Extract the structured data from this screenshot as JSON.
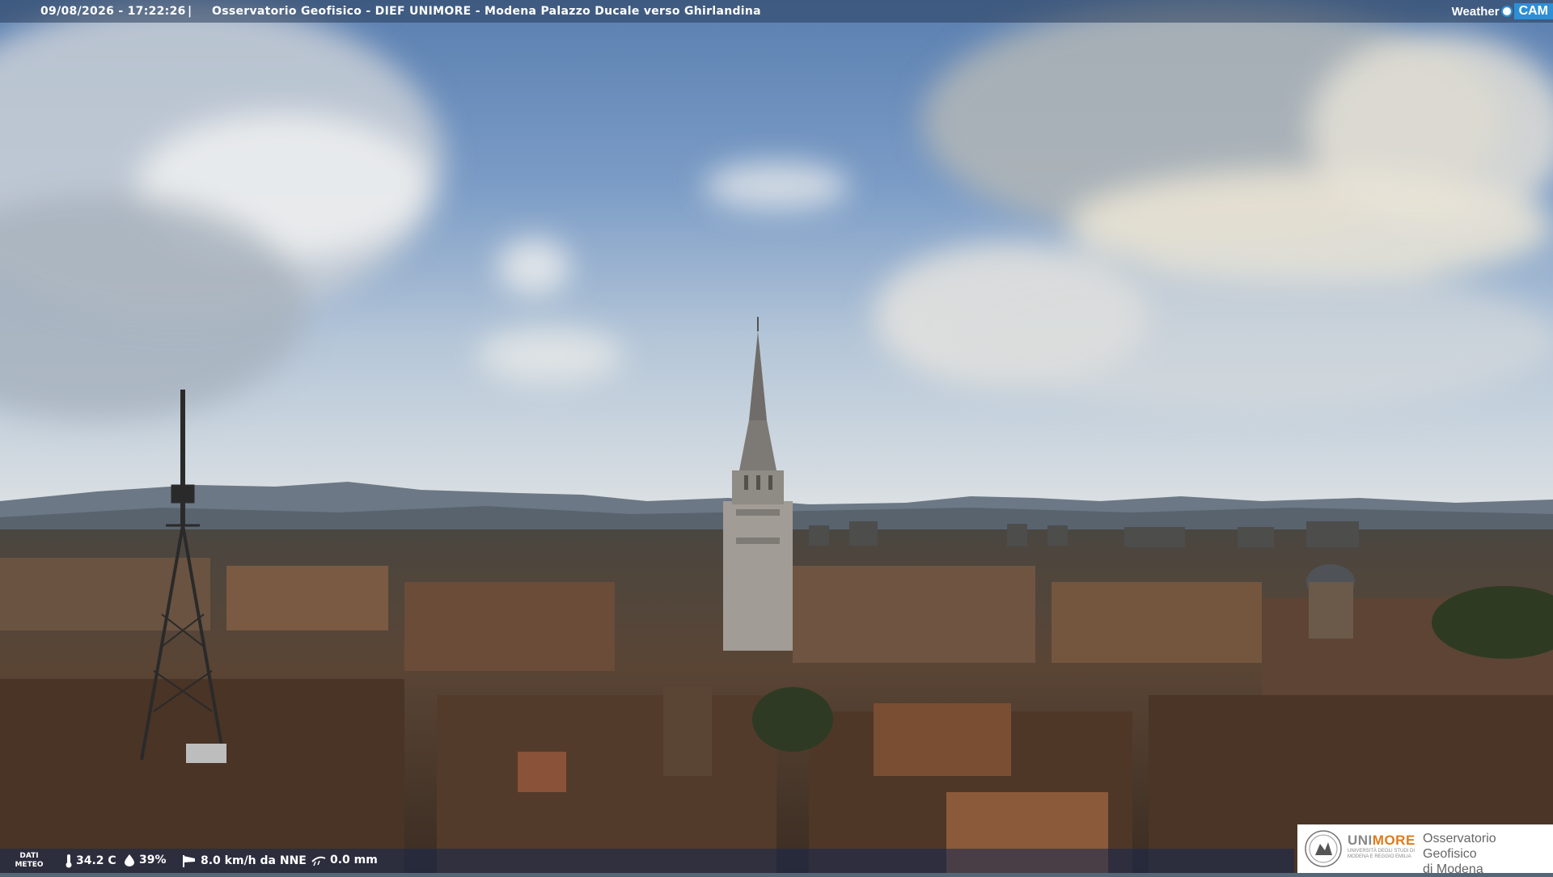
{
  "overlay": {
    "timestamp": "09/08/2026 - 17:22:26",
    "separator": "|",
    "title": "Osservatorio Geofisico - DIEF UNIMORE - Modena Palazzo Ducale verso Ghirlandina"
  },
  "brand": {
    "weather": "Weather",
    "cam": "CAM"
  },
  "weather_data": {
    "label_line1": "DATI",
    "label_line2": "METEO",
    "temperature": "34.2 C",
    "humidity": "39%",
    "wind": "8.0 km/h da NNE",
    "rain": "0.0 mm"
  },
  "logo": {
    "uni": "UNI",
    "more": "MORE",
    "university_sub": "UNIVERSITÀ DEGLI STUDI DI MODENA E REGGIO EMILIA",
    "observatory_line1": "Osservatorio Geofisico",
    "observatory_line2": "di Modena"
  },
  "icons": {
    "temperature": "thermometer-icon",
    "humidity": "droplet-icon",
    "wind": "wind-sock-icon",
    "rain": "rain-gauge-icon"
  }
}
